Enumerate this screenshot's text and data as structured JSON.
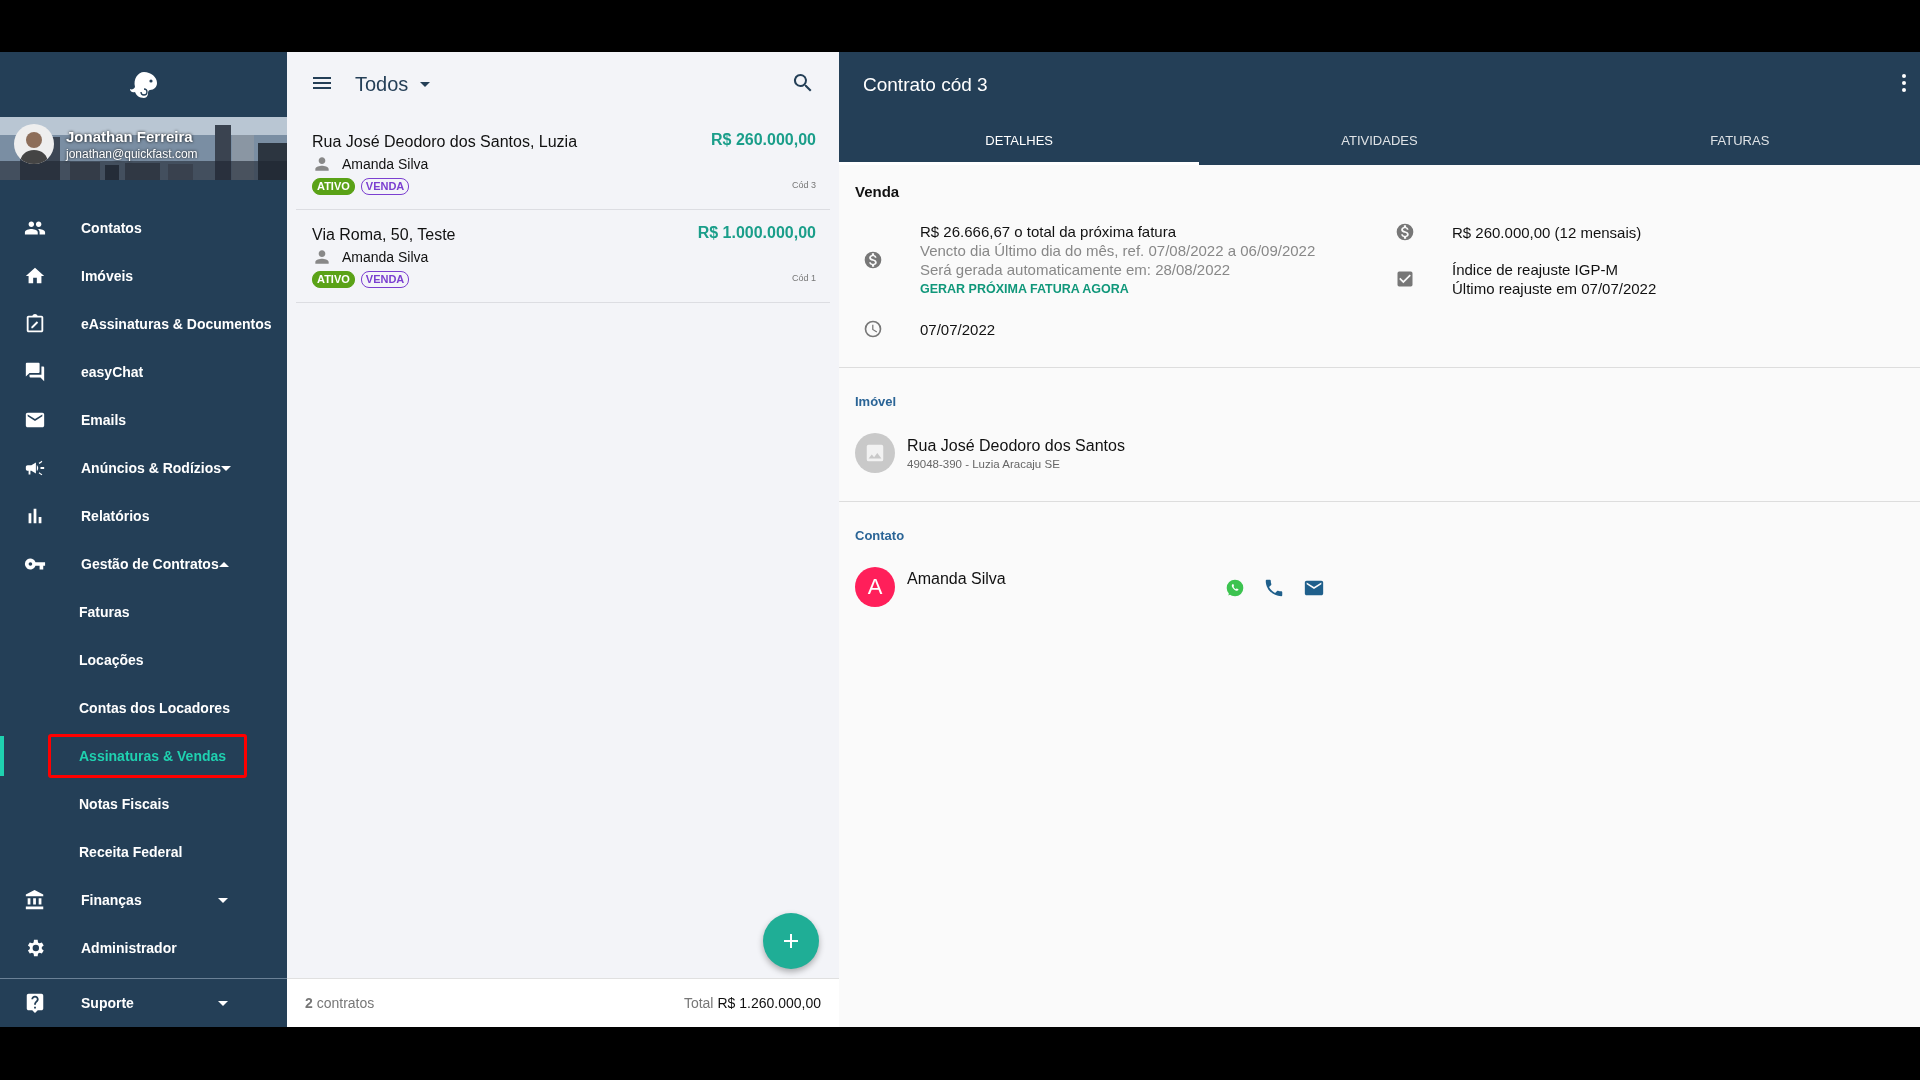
{
  "sidebar": {
    "user": {
      "name": "Jonathan Ferreira",
      "email": "jonathan@quickfast.com"
    },
    "items": [
      {
        "label": "Contatos",
        "selected": false
      },
      {
        "label": "Imóveis",
        "selected": false
      },
      {
        "label": "eAssinaturas & Documentos",
        "selected": false
      },
      {
        "label": "easyChat",
        "selected": false
      },
      {
        "label": "Emails",
        "selected": false
      },
      {
        "label": "Anúncios & Rodízios",
        "selected": false,
        "expanded": false
      },
      {
        "label": "Relatórios",
        "selected": false
      },
      {
        "label": "Gestão de Contratos",
        "selected": false,
        "expanded": true,
        "children": [
          {
            "label": "Faturas",
            "selected": false
          },
          {
            "label": "Locações",
            "selected": false
          },
          {
            "label": "Contas dos Locadores",
            "selected": false
          },
          {
            "label": "Assinaturas & Vendas",
            "selected": true
          },
          {
            "label": "Notas Fiscais",
            "selected": false
          },
          {
            "label": "Receita Federal",
            "selected": false
          }
        ]
      },
      {
        "label": "Finanças",
        "selected": false,
        "expanded": false
      },
      {
        "label": "Administrador",
        "selected": false
      }
    ],
    "footer": {
      "label": "Suporte",
      "expanded": false
    }
  },
  "list": {
    "filter": "Todos",
    "contracts": [
      {
        "address": "Rua José Deodoro dos Santos, Luzia",
        "contact": "Amanda Silva",
        "price": "R$ 260.000,00",
        "code": "Cód 3",
        "tags": [
          {
            "label": "ATIVO",
            "kind": "status"
          },
          {
            "label": "VENDA",
            "kind": "type"
          }
        ]
      },
      {
        "address": "Via Roma, 50, Teste",
        "contact": "Amanda Silva",
        "price": "R$ 1.000.000,00",
        "code": "Cód 1",
        "tags": [
          {
            "label": "ATIVO",
            "kind": "status"
          },
          {
            "label": "VENDA",
            "kind": "type"
          }
        ]
      }
    ],
    "footer": {
      "count": "2",
      "count_label": "contratos",
      "total_label": "Total",
      "total": "R$ 1.260.000,00"
    }
  },
  "detail": {
    "title": "Contrato cód 3",
    "tabs": [
      {
        "label": "DETALHES",
        "selected": true
      },
      {
        "label": "ATIVIDADES",
        "selected": false
      },
      {
        "label": "FATURAS",
        "selected": false
      }
    ],
    "sale": {
      "heading": "Venda",
      "next_invoice": {
        "amount": "R$ 26.666,67 o total da próxima fatura",
        "due": "Vencto dia Último dia do mês, ref. 07/08/2022 a 06/09/2022",
        "auto": "Será gerada automaticamente em: 28/08/2022",
        "action": "GERAR PRÓXIMA FATURA AGORA"
      },
      "date": "07/07/2022",
      "total": "R$ 260.000,00 (12 mensais)",
      "adjustment": {
        "index": "Índice de reajuste IGP-M",
        "last": "Último reajuste em 07/07/2022",
        "checked": true
      }
    },
    "property": {
      "heading": "Imóvel",
      "address": "Rua José Deodoro dos Santos",
      "location": "49048-390 - Luzia Aracaju SE"
    },
    "contact": {
      "heading": "Contato",
      "initial": "A",
      "name": "Amanda Silva",
      "color": "#ff1f5a"
    }
  }
}
